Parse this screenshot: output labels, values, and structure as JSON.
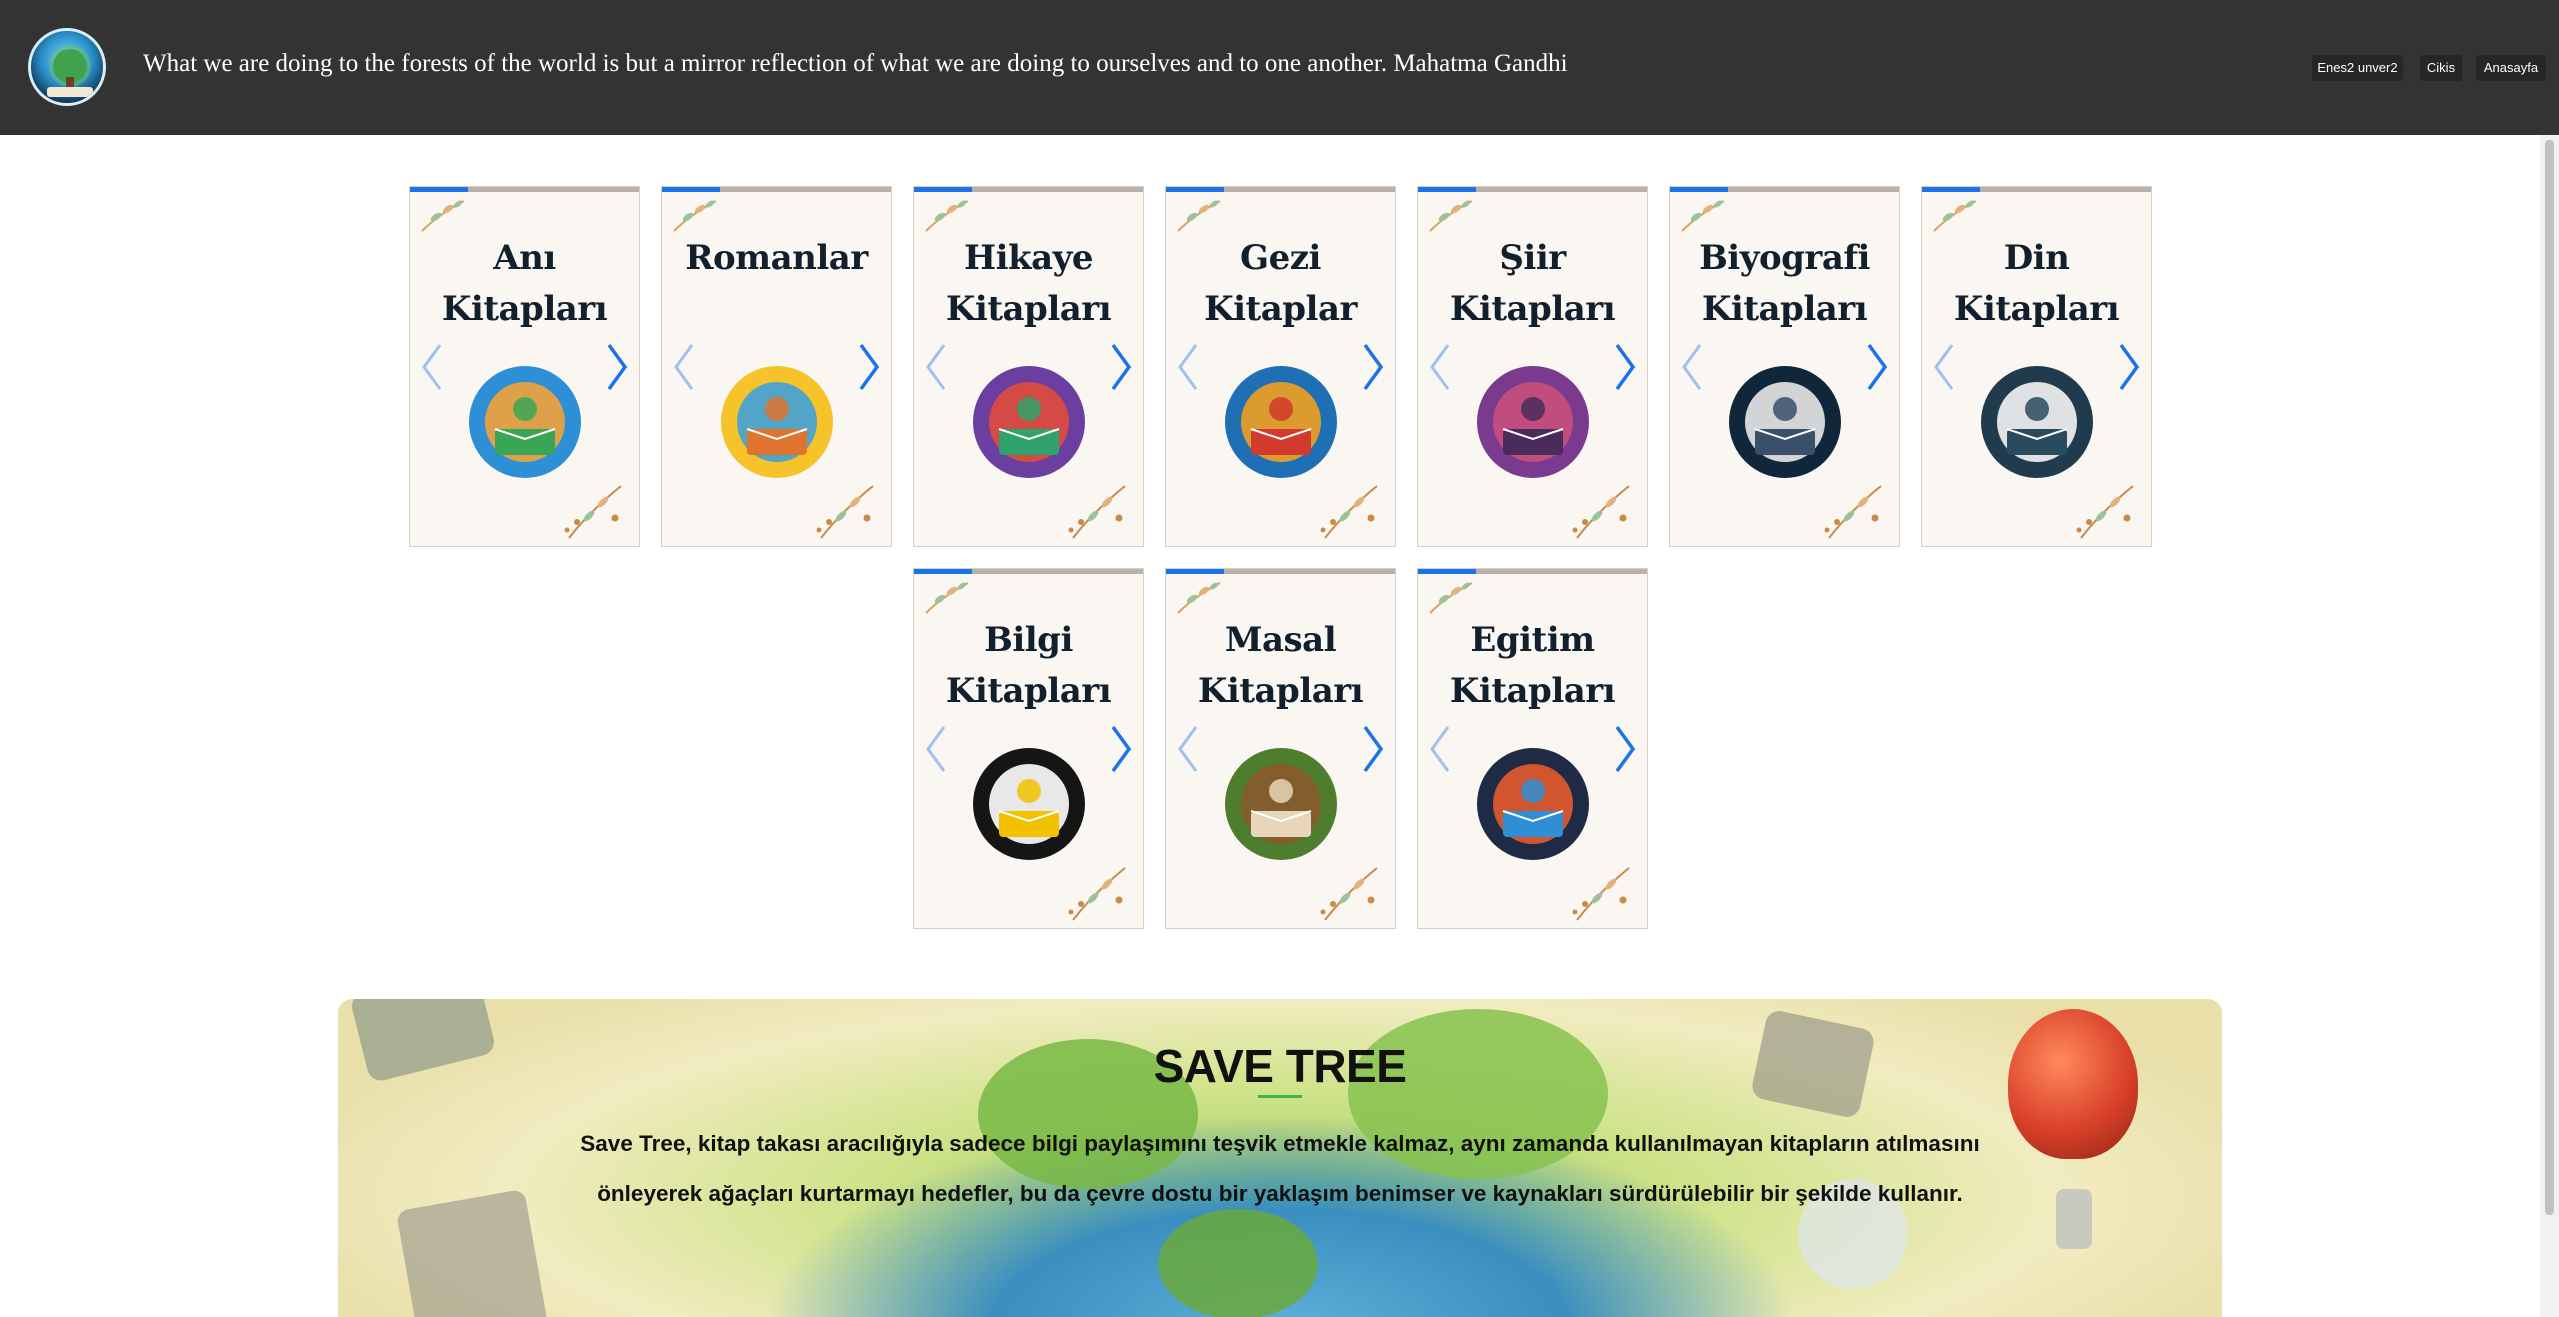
{
  "header": {
    "quote": "What we are doing to the forests of the world is but a mirror reflection of what we are doing to ourselves and to one another. Mahatma Gandhi",
    "logo_icon": "tree-globe-book-logo",
    "nav": {
      "user": "Enes2 unver2",
      "logout": "Cikis",
      "home": "Anasayfa"
    }
  },
  "categories": [
    {
      "title": "Anı Kitapları",
      "icon": "globe-travel-icon"
    },
    {
      "title": "Romanlar",
      "icon": "sun-landscape-icon"
    },
    {
      "title": "Hikaye Kitapları",
      "icon": "storybook-castle-icon"
    },
    {
      "title": "Gezi Kitaplar",
      "icon": "around-the-world-icon"
    },
    {
      "title": "Şiir Kitapları",
      "icon": "rose-quill-icon"
    },
    {
      "title": "Biyografi Kitapları",
      "icon": "book-quill-badge-icon"
    },
    {
      "title": "Din Kitapları",
      "icon": "open-book-laurel-icon"
    },
    {
      "title": "Bilgi Kitapları",
      "icon": "book-lightbulb-icon"
    },
    {
      "title": "Masal Kitapları",
      "icon": "fairy-tale-book-icon"
    },
    {
      "title": "Egitim Kitapları",
      "icon": "graduation-globe-book-icon"
    }
  ],
  "banner": {
    "title": "SAVE TREE",
    "text": "Save Tree, kitap takası aracılığıyla sadece bilgi paylaşımını teşvik etmekle kalmaz, aynı zamanda kullanılmayan kitapların atılmasını önleyerek ağaçları kurtarmayı hedefler, bu da çevre dostu bir yaklaşım benimser ve kaynakları sürdürülebilir bir şekilde kullanır."
  },
  "colors": {
    "header_bg": "#333333",
    "accent_blue": "#1a73e8",
    "card_bg": "#faf6f1",
    "title_text": "#12202e",
    "underline_green": "#3bb54a"
  }
}
